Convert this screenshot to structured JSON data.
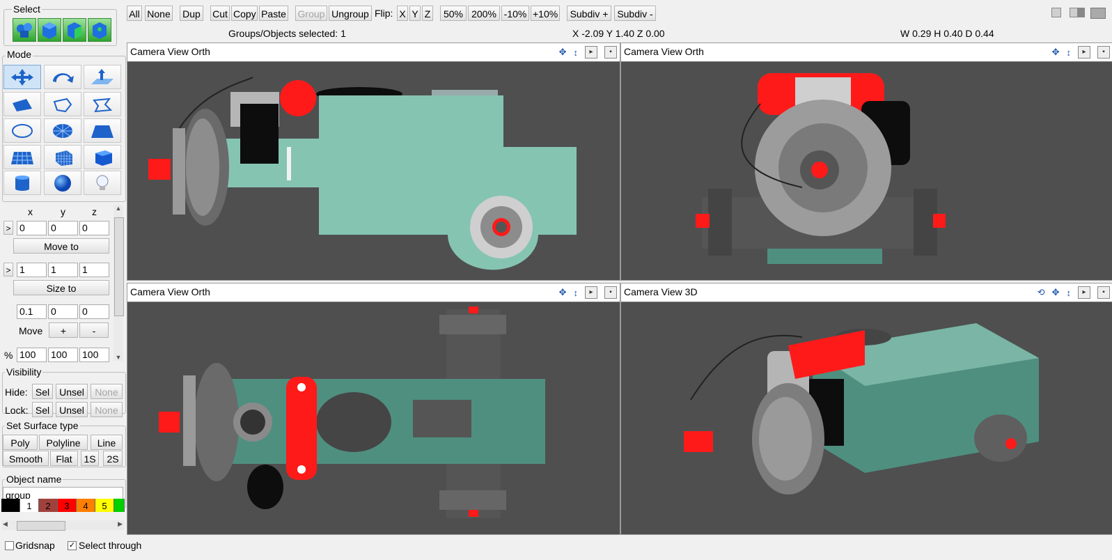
{
  "select": {
    "title": "Select",
    "icons": [
      "select-group-icon",
      "select-object-icon",
      "select-face-icon",
      "select-vertex-icon"
    ]
  },
  "toolbar": {
    "all": "All",
    "none": "None",
    "dup": "Dup",
    "cut": "Cut",
    "copy": "Copy",
    "paste": "Paste",
    "group": "Group",
    "ungroup": "Ungroup",
    "flip": "Flip:",
    "flip_x": "X",
    "flip_y": "Y",
    "flip_z": "Z",
    "zoom50": "50%",
    "zoom200": "200%",
    "minus10": "-10%",
    "plus10": "+10%",
    "subdiv_plus": "Subdiv +",
    "subdiv_minus": "Subdiv -"
  },
  "status": {
    "selected": "Groups/Objects selected: 1",
    "coords": "X -2.09 Y 1.40 Z 0.00",
    "dims": "W 0.29 H 0.40 D 0.44"
  },
  "mode": {
    "title": "Mode",
    "tools": [
      "move-icon",
      "rotate-icon",
      "extrude-icon",
      "face-icon",
      "polygon-icon",
      "freeform-icon",
      "ellipse-icon",
      "disc-icon",
      "plane-icon",
      "grid-icon",
      "cube-mesh-icon",
      "cube-icon",
      "cylinder-icon",
      "sphere-icon",
      "light-bulb-icon"
    ]
  },
  "transform": {
    "x_label": "x",
    "y_label": "y",
    "z_label": "z",
    "arrow": ">",
    "pos": [
      "0",
      "0",
      "0"
    ],
    "move_to": "Move to",
    "size": [
      "1",
      "1",
      "1"
    ],
    "size_to": "Size to",
    "step": [
      "0.1",
      "0",
      "0"
    ],
    "move_label": "Move",
    "plus": "+",
    "minus": "-",
    "pct_label": "%",
    "pct": [
      "100",
      "100",
      "100"
    ]
  },
  "visibility": {
    "title": "Visibility",
    "hide": "Hide:",
    "lock": "Lock:",
    "sel": "Sel",
    "unsel": "Unsel",
    "none": "None"
  },
  "surface": {
    "title": "Set Surface type",
    "poly": "Poly",
    "polyline": "Polyline",
    "line": "Line",
    "smooth": "Smooth",
    "flat": "Flat",
    "s1": "1S",
    "s2": "2S"
  },
  "object": {
    "title": "Object name",
    "name": "group"
  },
  "palette": [
    {
      "label": "",
      "color": "#000000"
    },
    {
      "label": "1",
      "color": "#ffffff"
    },
    {
      "label": "2",
      "color": "#a0413c"
    },
    {
      "label": "3",
      "color": "#ff0000"
    },
    {
      "label": "4",
      "color": "#ff7f00"
    },
    {
      "label": "5",
      "color": "#ffff00"
    },
    {
      "label": "",
      "color": "#00d000"
    }
  ],
  "footer": {
    "gridsnap": "Gridsnap",
    "select_through": "Select through",
    "gridsnap_checked": false,
    "select_through_checked": true
  },
  "viewports": [
    {
      "title": "Camera  View  Orth"
    },
    {
      "title": "Camera  View  Orth"
    },
    {
      "title": "Camera  View  Orth"
    },
    {
      "title": "Camera  View  3D"
    }
  ],
  "colors": {
    "viewport_bg": "#4f4f4f",
    "body_teal": "#86c4b2",
    "body_teal_dark": "#4f8f80",
    "red": "#ff1a1a",
    "accent_blue": "#1d54a8"
  }
}
